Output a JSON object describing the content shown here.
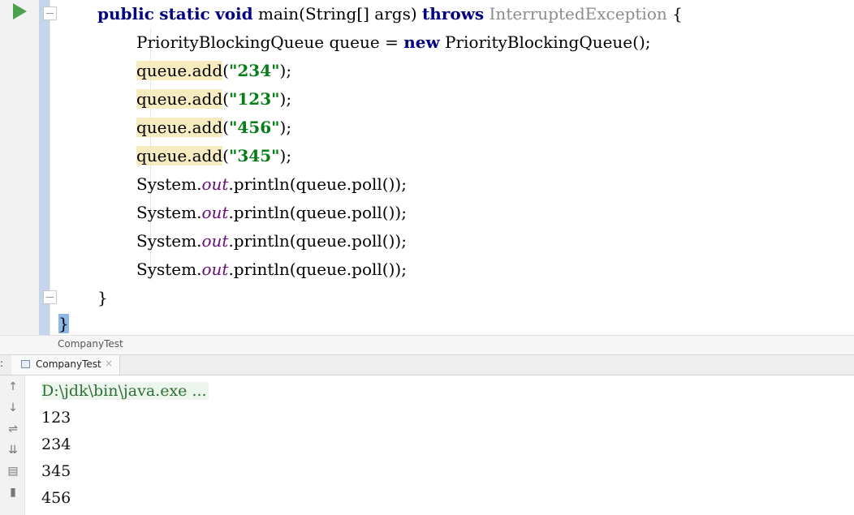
{
  "editor": {
    "lines": {
      "l1": {
        "kw1": "public",
        "kw2": "static",
        "kw3": "void",
        "t1": "main(String[] args)",
        "kw4": "throws",
        "exc": "InterruptedException",
        "t2": "{"
      },
      "l2": {
        "t1": "PriorityBlockingQueue queue = ",
        "kw1": "new",
        "t2": "PriorityBlockingQueue();"
      },
      "l3": {
        "call": "queue.add",
        "open": "(",
        "str": "\"234\"",
        "close": ");"
      },
      "l4": {
        "call": "queue.add",
        "open": "(",
        "str": "\"123\"",
        "close": ");"
      },
      "l5": {
        "call": "queue.add",
        "open": "(",
        "str": "\"456\"",
        "close": ");"
      },
      "l6": {
        "call": "queue.add",
        "open": "(",
        "str": "\"345\"",
        "close": ");"
      },
      "l7": {
        "t1": "System.",
        "fld": "out",
        "t2": ".println(queue.poll());"
      },
      "l8": {
        "t1": "System.",
        "fld": "out",
        "t2": ".println(queue.poll());"
      },
      "l9": {
        "t1": "System.",
        "fld": "out",
        "t2": ".println(queue.poll());"
      },
      "l10": {
        "t1": "System.",
        "fld": "out",
        "t2": ".println(queue.poll());"
      },
      "l11": {
        "t1": "}"
      },
      "l12": {
        "t1": "}"
      }
    }
  },
  "breadcrumb": {
    "label": "CompanyTest"
  },
  "run_panel": {
    "left_mark": ":",
    "tab_label": "CompanyTest",
    "tab_close": "×",
    "icons": {
      "up": {
        "name": "up-arrow-icon",
        "glyph": "↑"
      },
      "down": {
        "name": "down-arrow-icon",
        "glyph": "↓"
      },
      "wrap": {
        "name": "soft-wrap-icon",
        "glyph": "⇌"
      },
      "scroll": {
        "name": "scroll-to-end-icon",
        "glyph": "⇊"
      },
      "print": {
        "name": "print-icon",
        "glyph": "▤"
      },
      "trash": {
        "name": "trash-icon",
        "glyph": "▮"
      }
    },
    "output": {
      "command": "D:\\jdk\\bin\\java.exe ...",
      "lines": [
        "123",
        "234",
        "345",
        "456"
      ]
    }
  },
  "colors": {
    "keyword": "#000080",
    "string": "#067d17",
    "field": "#660e7a",
    "run": "#4ca14c",
    "highlight": "#f7ecc0"
  }
}
